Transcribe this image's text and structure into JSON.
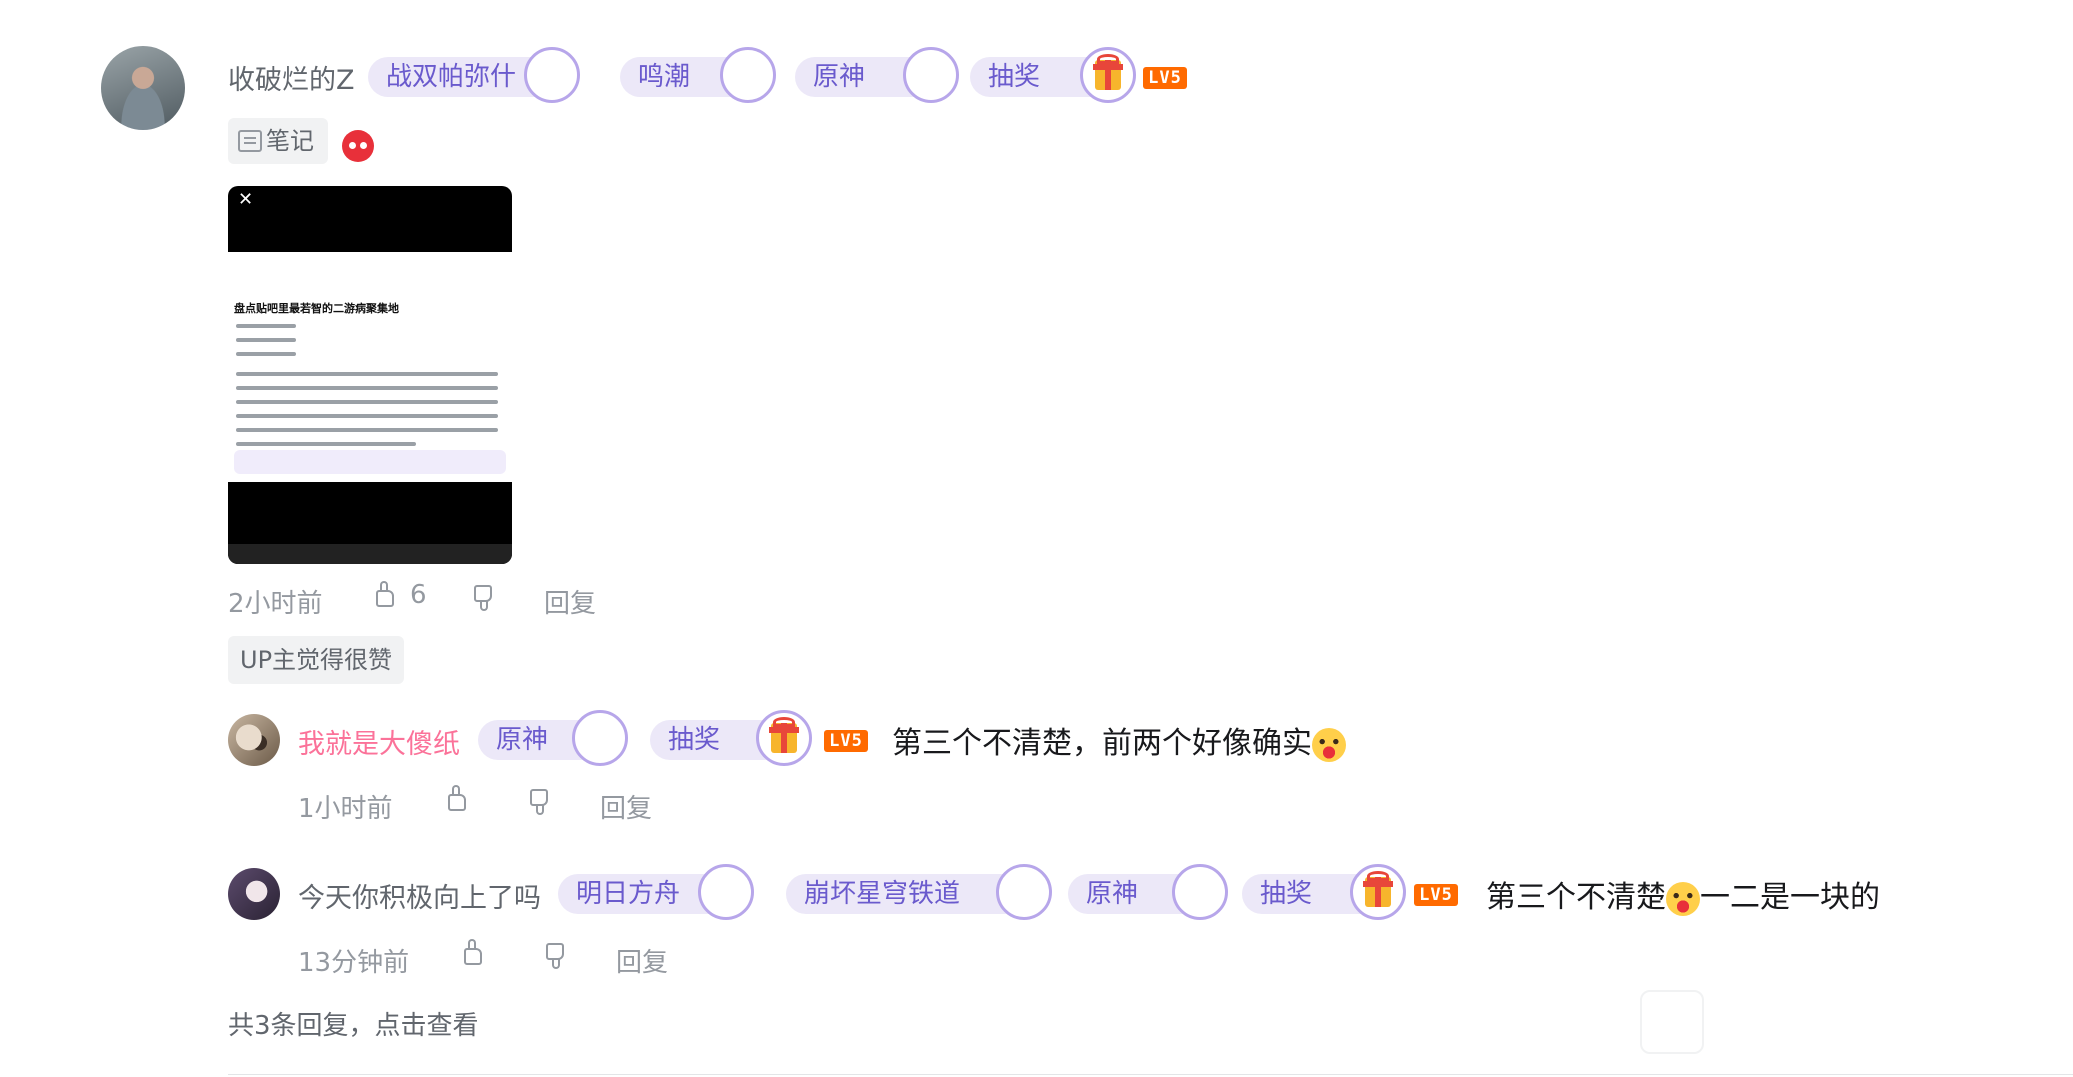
{
  "comment": {
    "username": "收破烂的Z",
    "level": "LV5",
    "badges": [
      {
        "label": "战双帕弥什",
        "icon": "zhanshuang-avatar-icon"
      },
      {
        "label": "鸣潮",
        "icon": "mingchao-avatar-icon"
      },
      {
        "label": "原神",
        "icon": "yuanshen-avatar-icon"
      },
      {
        "label": "抽奖",
        "icon": "gift-icon"
      }
    ],
    "note_tag": "笔记",
    "image_title": "盘点贴吧里最若智的二游病聚集地",
    "time": "2小时前",
    "likes": "6",
    "reply_label": "回复",
    "up_tag": "UP主觉得很赞"
  },
  "replies": [
    {
      "username": "我就是大傻纸",
      "badges": [
        {
          "label": "原神",
          "icon": "yuanshen-avatar-icon"
        },
        {
          "label": "抽奖",
          "icon": "gift-icon"
        }
      ],
      "level": "LV5",
      "text": "第三个不清楚，前两个好像确实",
      "time": "1小时前",
      "reply_label": "回复"
    },
    {
      "username": "今天你积极向上了吗",
      "badges": [
        {
          "label": "明日方舟",
          "icon": "mingri-avatar-icon"
        },
        {
          "label": "崩坏星穹铁道",
          "icon": "benghuai-avatar-icon"
        },
        {
          "label": "原神",
          "icon": "yuanshen-avatar-icon"
        },
        {
          "label": "抽奖",
          "icon": "gift-icon"
        }
      ],
      "level": "LV5",
      "text_before": "第三个不清楚",
      "text_after": "一二是一块的",
      "time": "13分钟前",
      "reply_label": "回复"
    }
  ],
  "view_more": "共3条回复，点击查看"
}
